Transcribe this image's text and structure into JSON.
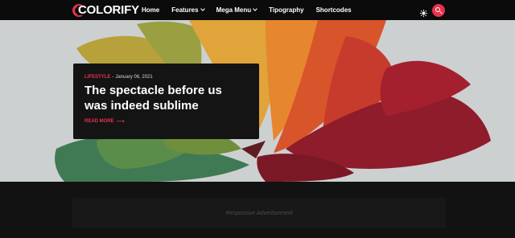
{
  "header": {
    "logo_text": "COLORIFY",
    "nav": [
      {
        "label": "Home",
        "has_dropdown": false
      },
      {
        "label": "Features",
        "has_dropdown": true
      },
      {
        "label": "Mega Menu",
        "has_dropdown": true
      },
      {
        "label": "Tipography",
        "has_dropdown": false
      },
      {
        "label": "Shortcodes",
        "has_dropdown": false
      }
    ],
    "theme_toggle_icon": "sun-icon",
    "search_icon": "search-icon"
  },
  "featured": {
    "category": "LIFESTYLE",
    "separator": "-",
    "date": "January 06, 2021",
    "title": "The spectacle before us was indeed sublime",
    "read_more": "READ MORE",
    "read_more_icon": "arrow-right-icon"
  },
  "ad": {
    "label": "Responsive Advertisement"
  },
  "colors": {
    "accent": "#e8324b",
    "header_bg": "#0b0b0b",
    "page_bg": "#121212",
    "card_bg": "#141414",
    "ad_bg": "#181818"
  }
}
